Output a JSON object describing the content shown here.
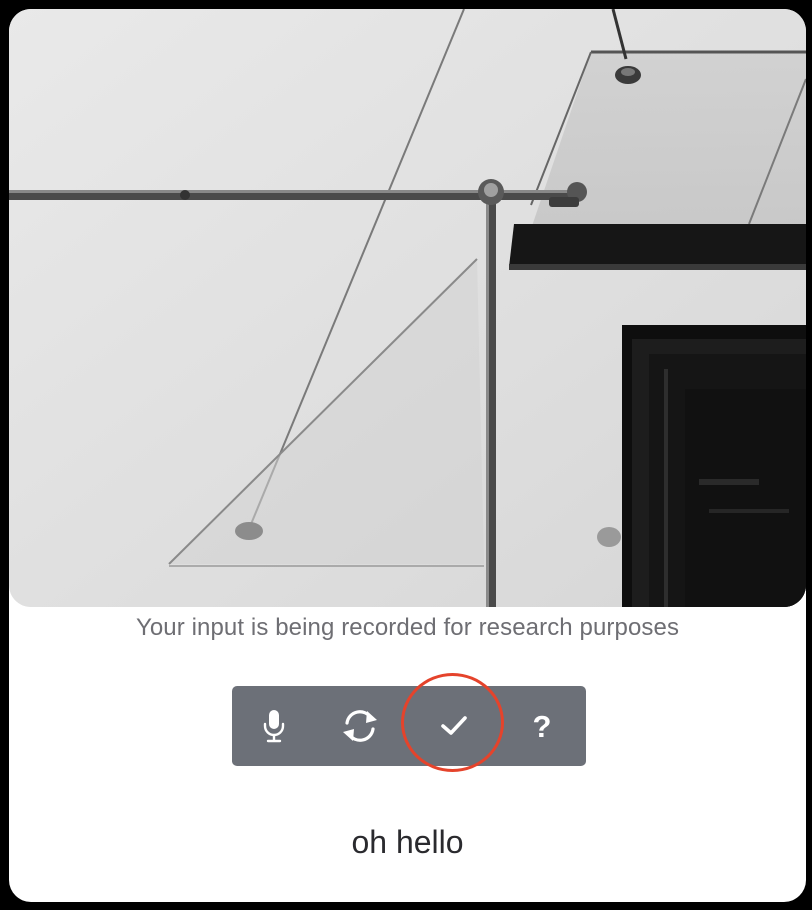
{
  "photo": {
    "alt": "Black and white photo of a white wall with a pipe, glass canopy and a dark window"
  },
  "caption": "Your input is being recorded for research purposes",
  "toolbar": {
    "buttons": [
      {
        "id": "mic",
        "icon": "microphone-icon"
      },
      {
        "id": "refresh",
        "icon": "refresh-icon"
      },
      {
        "id": "confirm",
        "icon": "checkmark-icon",
        "highlighted": true
      },
      {
        "id": "help",
        "icon": "help-icon",
        "glyph": "?"
      }
    ],
    "background": "#6c7078"
  },
  "highlight_color": "#e5432b",
  "transcript": "oh hello"
}
